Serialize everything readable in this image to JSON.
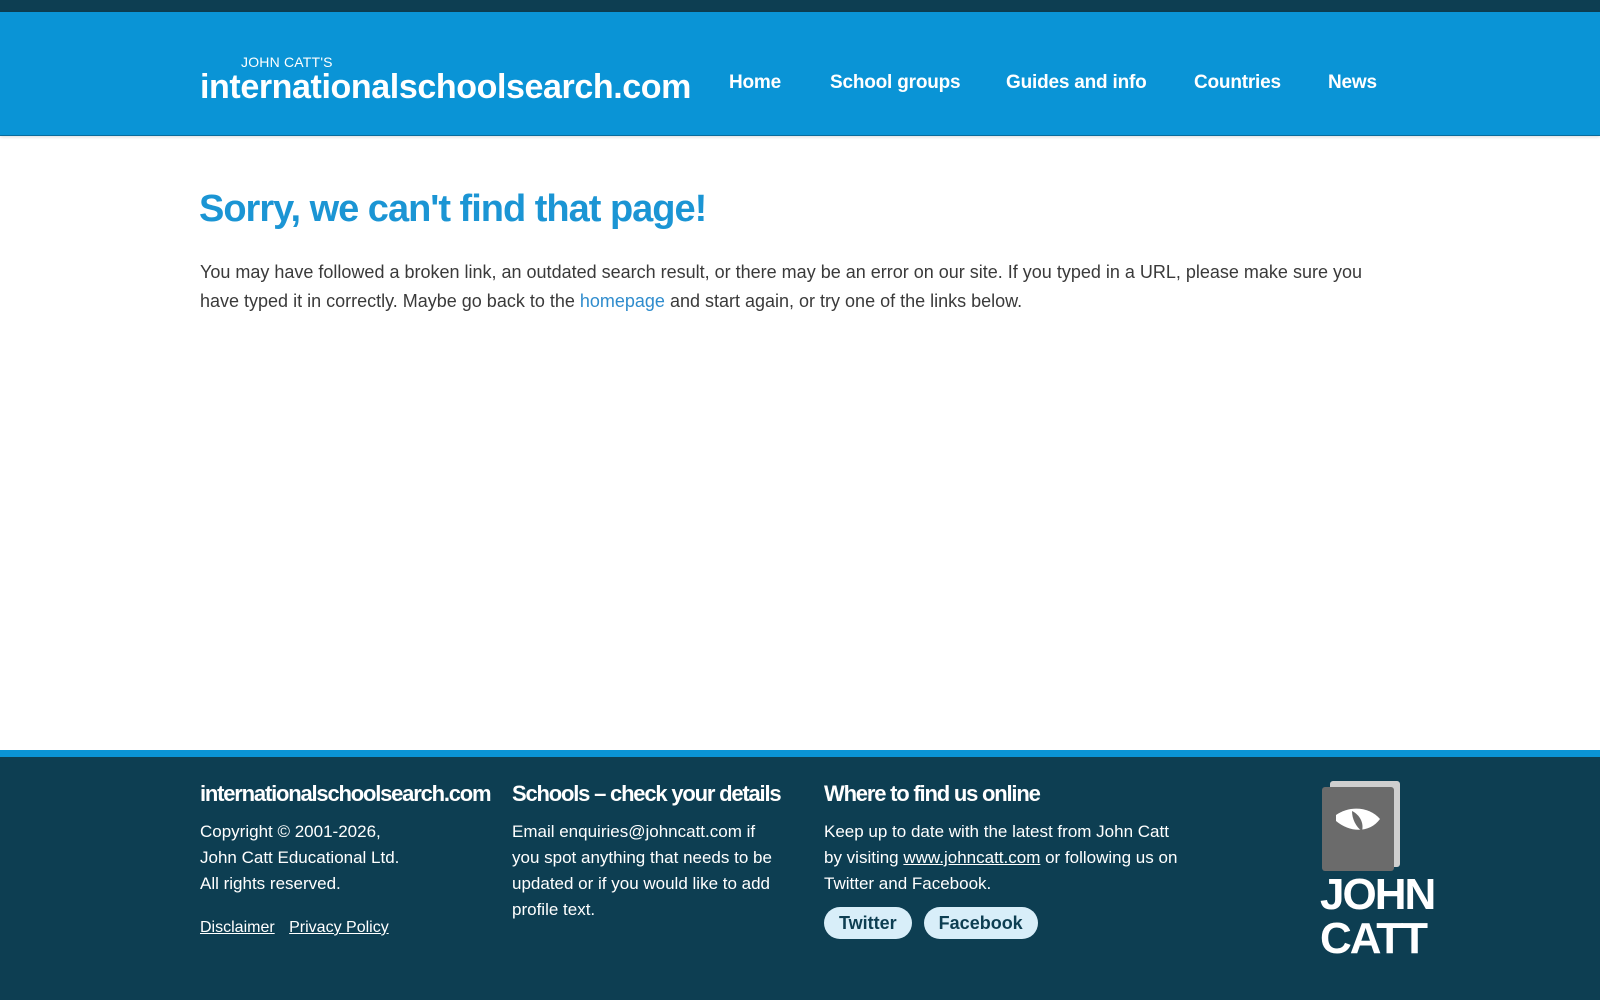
{
  "header": {
    "logo_small": "JOHN CATT'S",
    "logo_big": "internationalschoolsearch.com",
    "nav": [
      {
        "label": "Home"
      },
      {
        "label": "School groups"
      },
      {
        "label": "Guides and info"
      },
      {
        "label": "Countries"
      },
      {
        "label": "News"
      }
    ]
  },
  "main": {
    "title": "Sorry, we can't find that page!",
    "intro_before": "You may have followed a broken link, an outdated search result, or there may be an error on our site. If you typed in a URL, please make sure you have typed it in correctly. Maybe go back to the ",
    "intro_link": "homepage",
    "intro_after": " and start again, or try one of the links below."
  },
  "footer": {
    "col1": {
      "heading": "internationalschoolsearch.com",
      "line1": "Copyright © 2001-2026,",
      "line2": "John Catt Educational Ltd.",
      "line3": "All rights reserved.",
      "disclaimer": "Disclaimer",
      "privacy": "Privacy Policy"
    },
    "col2": {
      "heading": "Schools – check your details",
      "text": "Email enquiries@johncatt.com if you spot anything that needs to be updated or if you would like to add profile text."
    },
    "col3": {
      "heading": "Where to find us online",
      "text_before": "Keep up to date with the latest from John Catt by visiting ",
      "link": "www.johncatt.com",
      "text_after": " or following us on Twitter and Facebook.",
      "twitter": "Twitter",
      "facebook": "Facebook"
    },
    "brand": {
      "line1": "JOHN",
      "line2": "CATT"
    }
  },
  "colors": {
    "header_bg": "#0a94d6",
    "footer_bg": "#0d3e52",
    "title": "#1b95d4",
    "link": "#2f8ccd"
  }
}
